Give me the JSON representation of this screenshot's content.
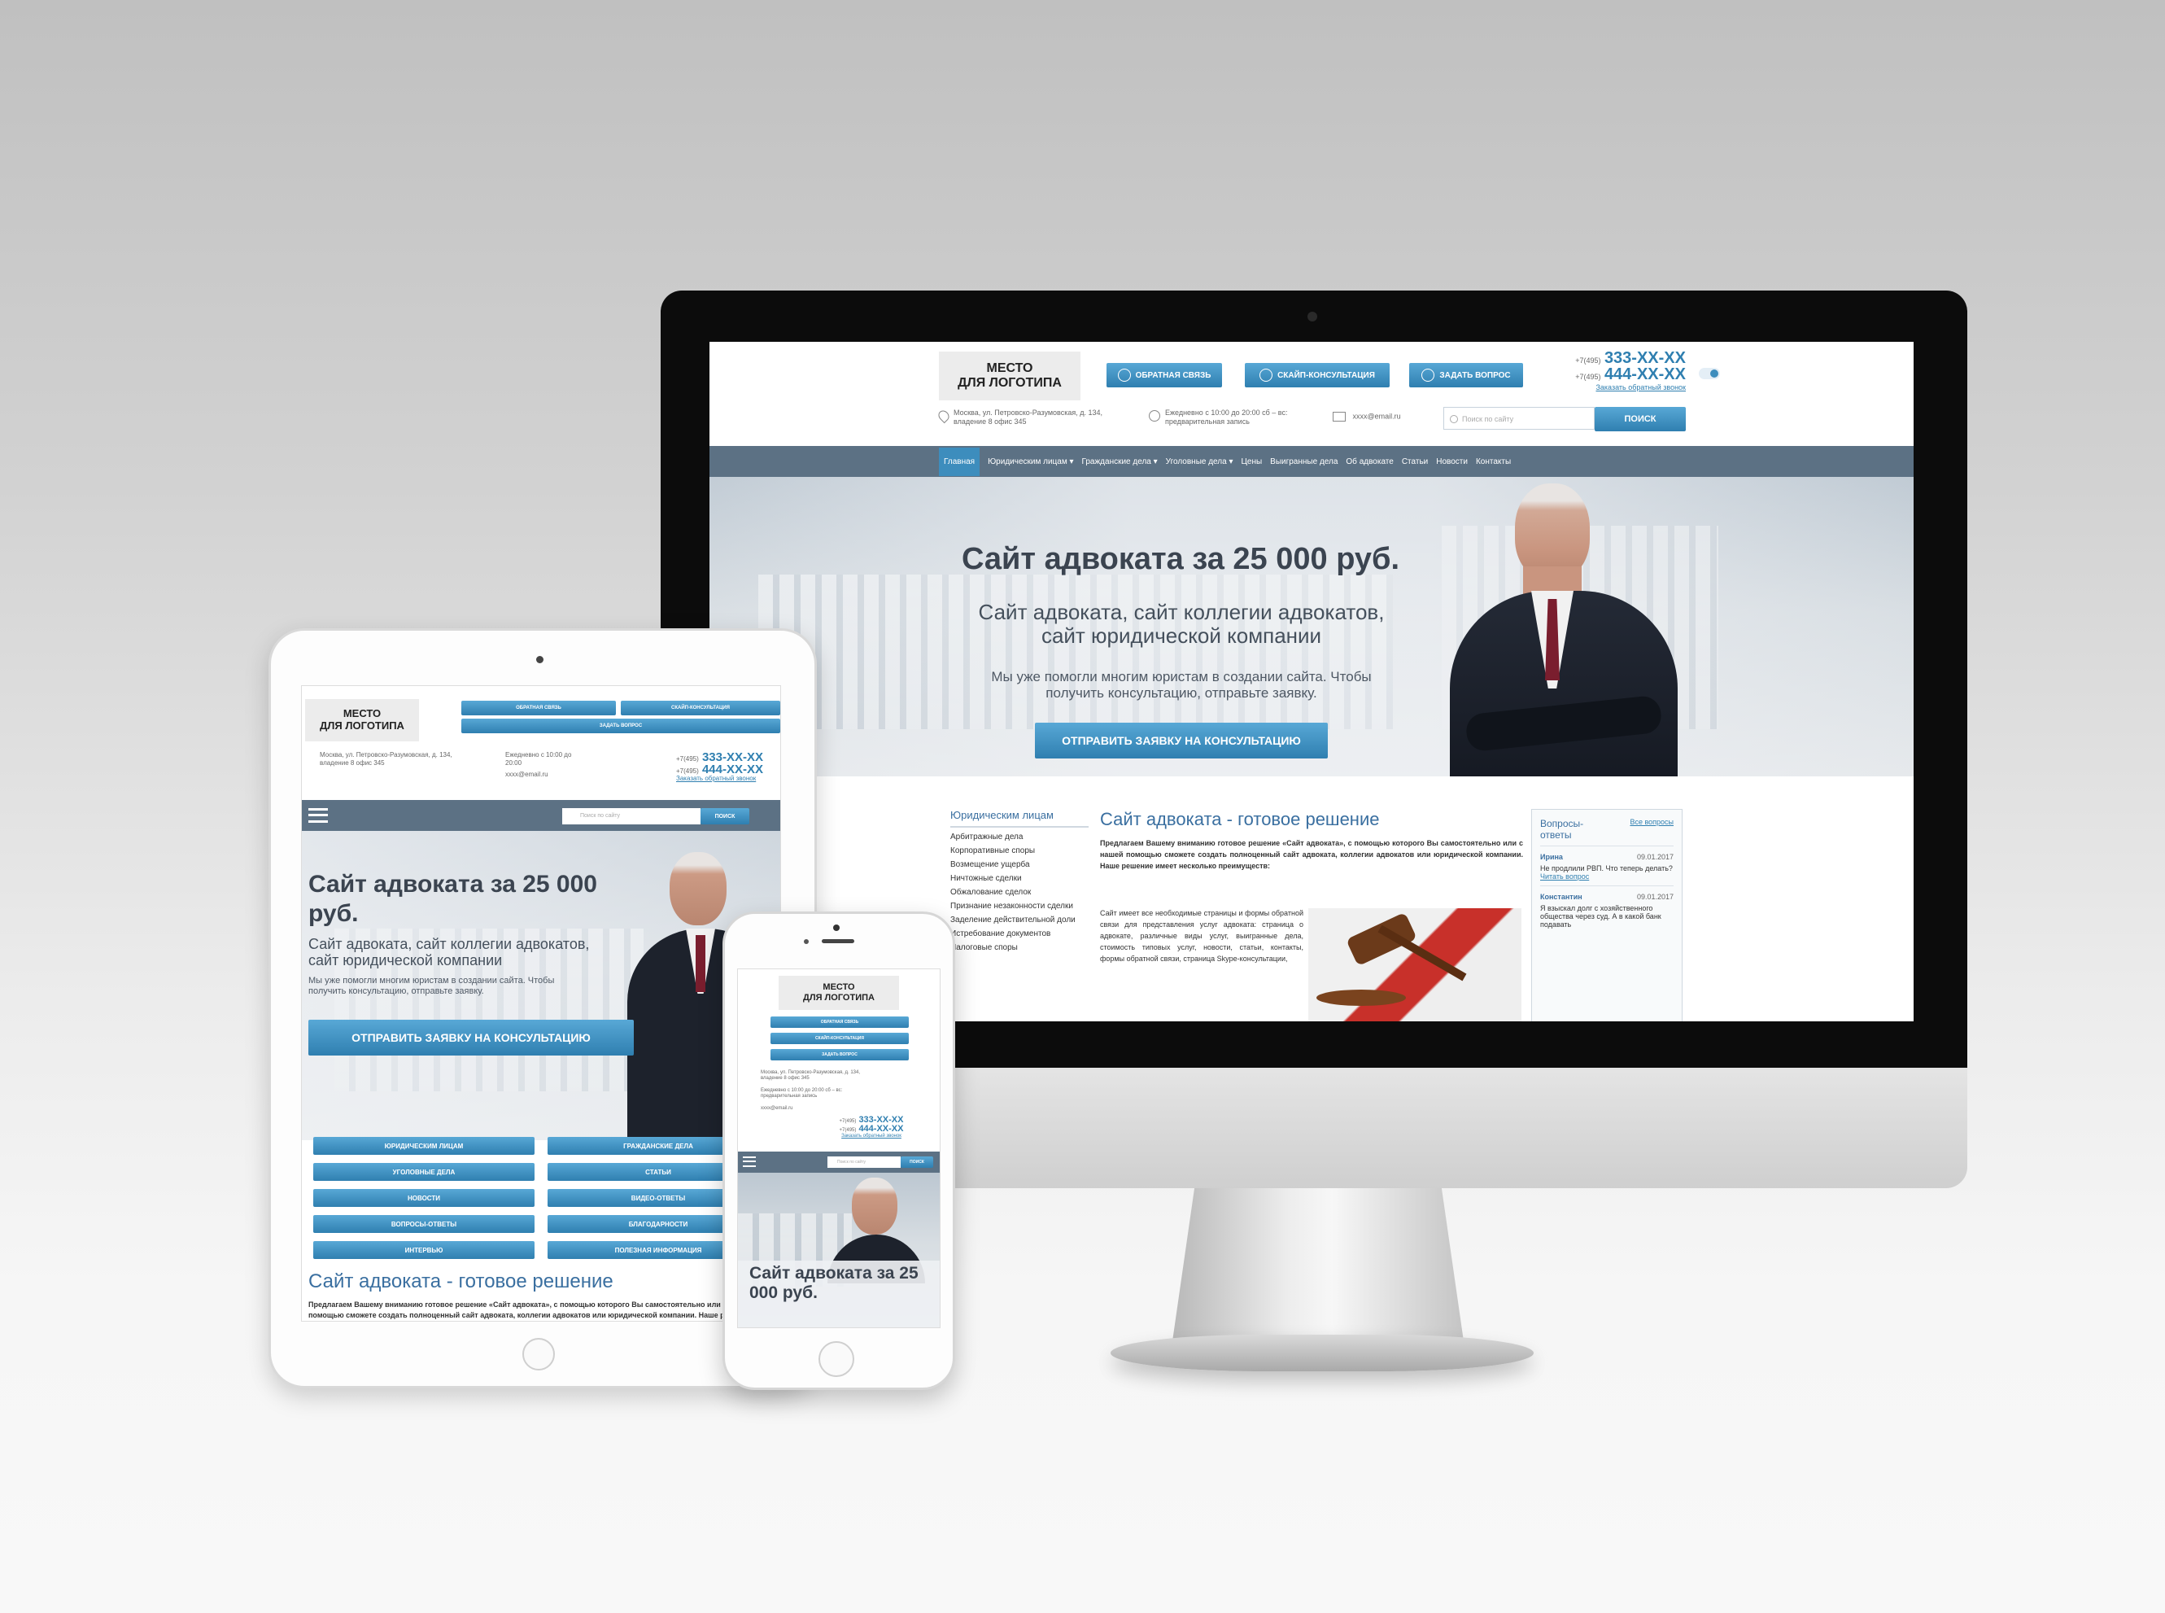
{
  "site": {
    "logo_line1": "МЕСТО",
    "logo_line2": "ДЛЯ ЛОГОТИПА",
    "buttons": {
      "callback": "ОБРАТНАЯ СВЯЗЬ",
      "skype": "СКАЙП-КОНСУЛЬТАЦИЯ",
      "question": "ЗАДАТЬ ВОПРОС"
    },
    "phone1_prefix": "+7(495)",
    "phone1": "333-XX-XX",
    "phone2_prefix": "+7(495)",
    "phone2": "444-XX-XX",
    "callback_link": "Заказать обратный звонок",
    "address": "Москва, ул. Петровско-Разумовская, д. 134, владение 8 офис 345",
    "hours": "Ежедневно с 10:00 до 20:00 сб – вс: предварительная запись",
    "email": "xxxx@email.ru",
    "search_placeholder": "Поиск по сайту",
    "search_button": "ПОИСК",
    "nav": [
      "Главная",
      "Юридическим лицам ▾",
      "Гражданские дела ▾",
      "Уголовные дела ▾",
      "Цены",
      "Выигранные дела",
      "Об адвокате",
      "Статьи",
      "Новости",
      "Контакты"
    ],
    "hero_title": "Сайт адвоката за 25 000 руб.",
    "hero_subtitle_1": "Сайт адвоката, сайт коллегии адвокатов,",
    "hero_subtitle_2": "сайт юридической компании",
    "hero_text_1": "Мы уже помогли многим юристам в создании сайта. Чтобы",
    "hero_text_2": "получить консультацию, отправьте заявку.",
    "hero_button": "ОТПРАВИТЬ ЗАЯВКУ НА КОНСУЛЬТАЦИЮ",
    "sidebar_title": "Юридическим лицам",
    "sidebar_items": [
      "Арбитражные дела",
      "Корпоративные споры",
      "Возмещение ущерба",
      "Ничтожные сделки",
      "Обжалование сделок",
      "Признание незаконности сделки",
      "Заделение действительной доли",
      "Истребование документов",
      "Налоговые споры"
    ],
    "content_title": "Сайт адвоката - готовое решение",
    "content_intro": "Предлагаем Вашему вниманию готовое решение «Сайт адвоката», с помощью которого Вы самостоятельно или с нашей помощью сможете создать полноценный сайт адвоката, коллегии адвокатов или юридической компании. Наше решение имеет несколько преимуществ:",
    "content_bullet": "Сайт имеет все необходимые страницы и формы обратной связи для представления услуг адвоката: страница о адвокате, различные виды услуг, выигранные дела, стоимость типовых услуг, новости, статьи, контакты, формы обратной связи, страница Skype-консультации,",
    "qa_title": "Вопросы-ответы",
    "qa_all": "Все вопросы",
    "qa_items": [
      {
        "name": "Ирина",
        "date": "09.01.2017",
        "text": "Не продлили РВП. Что теперь делать?",
        "link": "Читать вопрос"
      },
      {
        "name": "Константин",
        "date": "09.01.2017",
        "text": "Я взыскал долг с хозяйственного общества через суд. А в какой банк подавать"
      }
    ],
    "tablet_grid": [
      "ЮРИДИЧЕСКИМ ЛИЦАМ",
      "ГРАЖДАНСКИЕ ДЕЛА",
      "УГОЛОВНЫЕ ДЕЛА",
      "СТАТЬИ",
      "НОВОСТИ",
      "ВИДЕО-ОТВЕТЫ",
      "ВОПРОСЫ-ОТВЕТЫ",
      "БЛАГОДАРНОСТИ",
      "ИНТЕРВЬЮ",
      "ПОЛЕЗНАЯ ИНФОРМАЦИЯ"
    ],
    "tablet_hero_title": "Сайт адвоката за 25 000 руб.",
    "tablet_hours": "Ежедневно с 10:00 до 20:00",
    "phone_hero_title": "Сайт адвоката за 25 000 руб."
  },
  "colors": {
    "accent": "#3d8dbd",
    "nav": "#5c7184",
    "bezel": "#0c0c0c"
  }
}
